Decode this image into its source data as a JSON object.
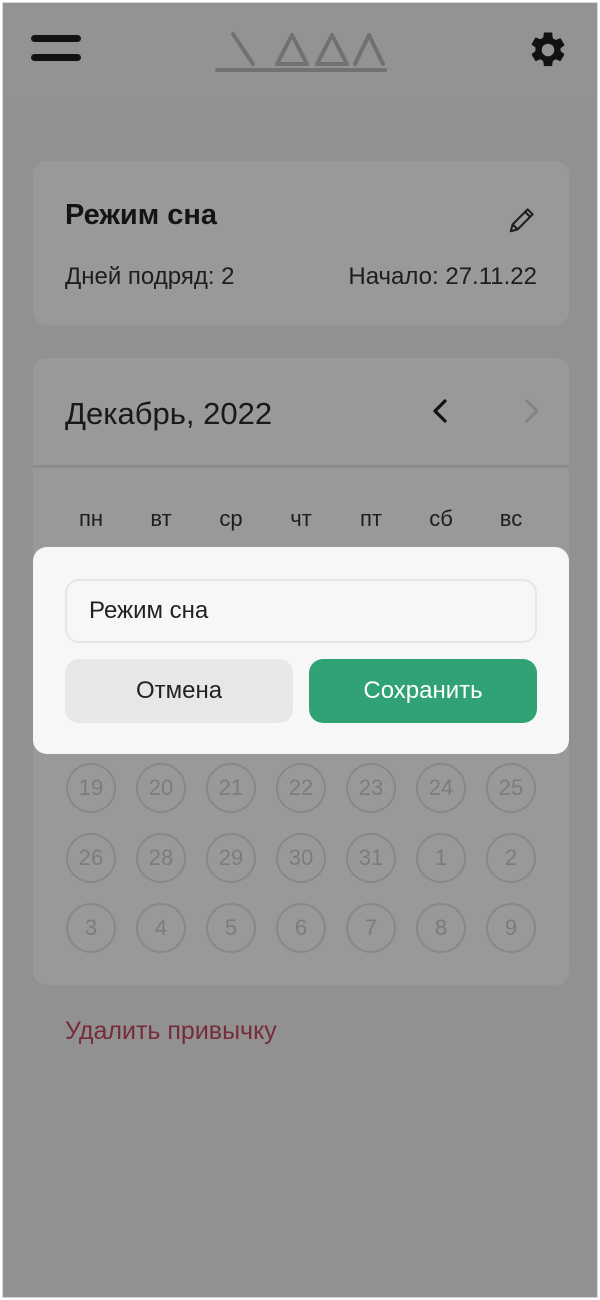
{
  "header": {
    "menu_icon": "menu-icon",
    "logo": "app-logo",
    "settings_icon": "gear-icon"
  },
  "habit": {
    "title": "Режим сна",
    "streak": "Дней подряд: 2",
    "start": "Начало: 27.11.22",
    "edit_icon": "pencil-icon"
  },
  "calendar": {
    "month": "Декабрь, 2022",
    "prev_icon": "chevron-left-icon",
    "next_icon": "chevron-right-icon",
    "weekdays": [
      "пн",
      "вт",
      "ср",
      "чт",
      "пт",
      "сб",
      "вс"
    ],
    "weeks": [
      [
        "19",
        "20",
        "21",
        "22",
        "23",
        "24",
        "25"
      ],
      [
        "26",
        "28",
        "29",
        "30",
        "31",
        "1",
        "2"
      ],
      [
        "3",
        "4",
        "5",
        "6",
        "7",
        "8",
        "9"
      ]
    ]
  },
  "delete_label": "Удалить привычку",
  "dialog": {
    "input_value": "Режим сна",
    "cancel_label": "Отмена",
    "save_label": "Сохранить"
  },
  "colors": {
    "accent": "#31a276",
    "danger": "#c54a63"
  }
}
